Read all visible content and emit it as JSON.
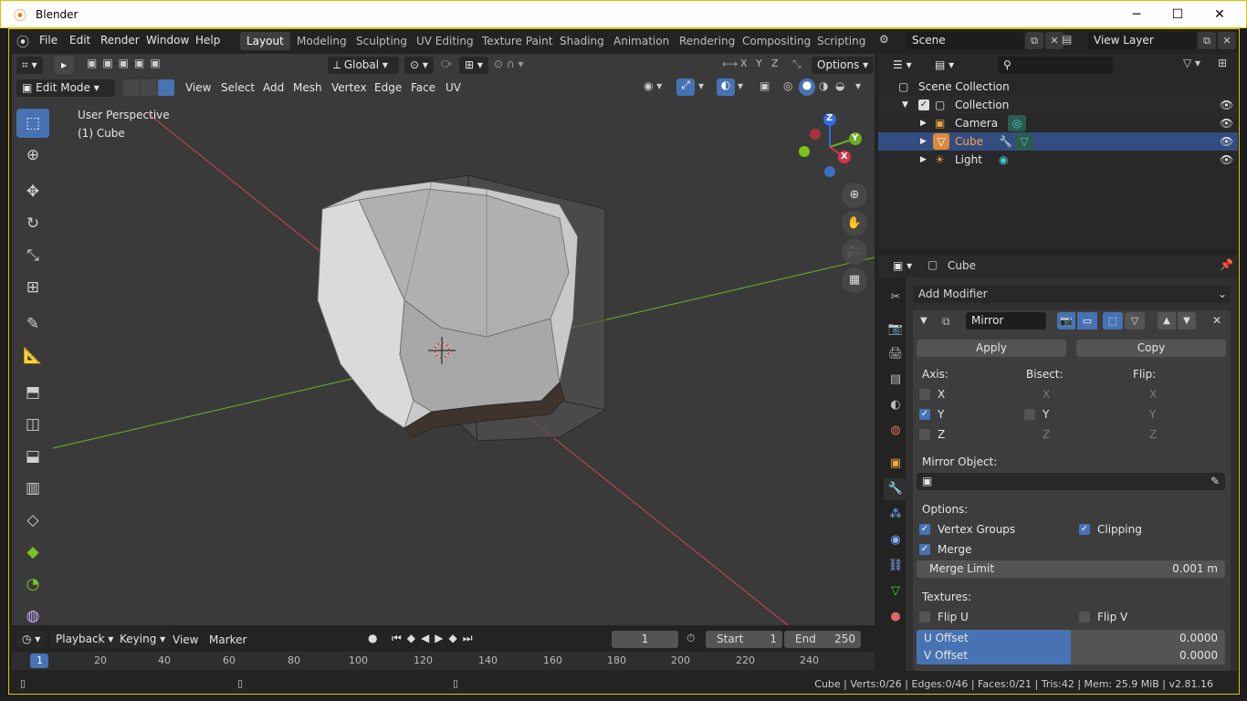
{
  "window": {
    "title": "Blender",
    "min": "─",
    "max": "☐",
    "close": "✕"
  },
  "menus": [
    "File",
    "Edit",
    "Render",
    "Window",
    "Help"
  ],
  "workspaces": [
    "Layout",
    "Modeling",
    "Sculpting",
    "UV Editing",
    "Texture Paint",
    "Shading",
    "Animation",
    "Rendering",
    "Compositing",
    "Scripting"
  ],
  "scene": {
    "name": "Scene",
    "view_layer": "View Layer"
  },
  "viewport": {
    "orientation": "Global",
    "mode": "Edit Mode",
    "menu": [
      "View",
      "Select",
      "Add",
      "Mesh",
      "Vertex",
      "Edge",
      "Face",
      "UV"
    ],
    "options": "Options",
    "axis_lock": [
      "X",
      "Y",
      "Z"
    ],
    "info_line1": "User Perspective",
    "info_line2": "(1) Cube",
    "gizmo": {
      "z": "Z",
      "y": "Y",
      "x": "X"
    }
  },
  "outliner": {
    "search_placeholder": "",
    "rows": [
      {
        "label": "Scene Collection",
        "icon": "scene-collection-icon"
      },
      {
        "label": "Collection",
        "icon": "collection-icon"
      },
      {
        "label": "Camera",
        "icon": "camera-object-icon"
      },
      {
        "label": "Cube",
        "icon": "mesh-object-icon"
      },
      {
        "label": "Light",
        "icon": "light-object-icon"
      }
    ]
  },
  "properties": {
    "object": "Cube",
    "add_modifier": "Add Modifier",
    "modifier_name": "Mirror",
    "apply": "Apply",
    "copy": "Copy",
    "axis_label": "Axis:",
    "bisect_label": "Bisect:",
    "flip_label": "Flip:",
    "axes": [
      "X",
      "Y",
      "Z"
    ],
    "mirror_object_label": "Mirror Object:",
    "options_label": "Options:",
    "vertex_groups": "Vertex Groups",
    "clipping": "Clipping",
    "merge": "Merge",
    "merge_limit_label": "Merge Limit",
    "merge_limit_value": "0.001 m",
    "textures_label": "Textures:",
    "flip_u": "Flip U",
    "flip_v": "Flip V",
    "u_offset_label": "U Offset",
    "u_offset_value": "0.0000",
    "v_offset_label": "V Offset",
    "v_offset_value": "0.0000",
    "offset_fill": 0.5
  },
  "timeline": {
    "menus": [
      "Playback",
      "Keying",
      "View",
      "Marker"
    ],
    "current_frame": "1",
    "start_label": "Start",
    "start": "1",
    "end_label": "End",
    "end": "250",
    "ticks": [
      "1",
      "20",
      "40",
      "60",
      "80",
      "100",
      "120",
      "140",
      "160",
      "180",
      "200",
      "220",
      "240"
    ]
  },
  "status": {
    "text": "Cube | Verts:0/26 | Edges:0/46 | Faces:0/21 | Tris:42 | Mem: 25.9 MiB | v2.81.16"
  },
  "colors": {
    "accent": "#4772b3",
    "selected_row": "#334d80",
    "frame_border": "#e1c000"
  }
}
